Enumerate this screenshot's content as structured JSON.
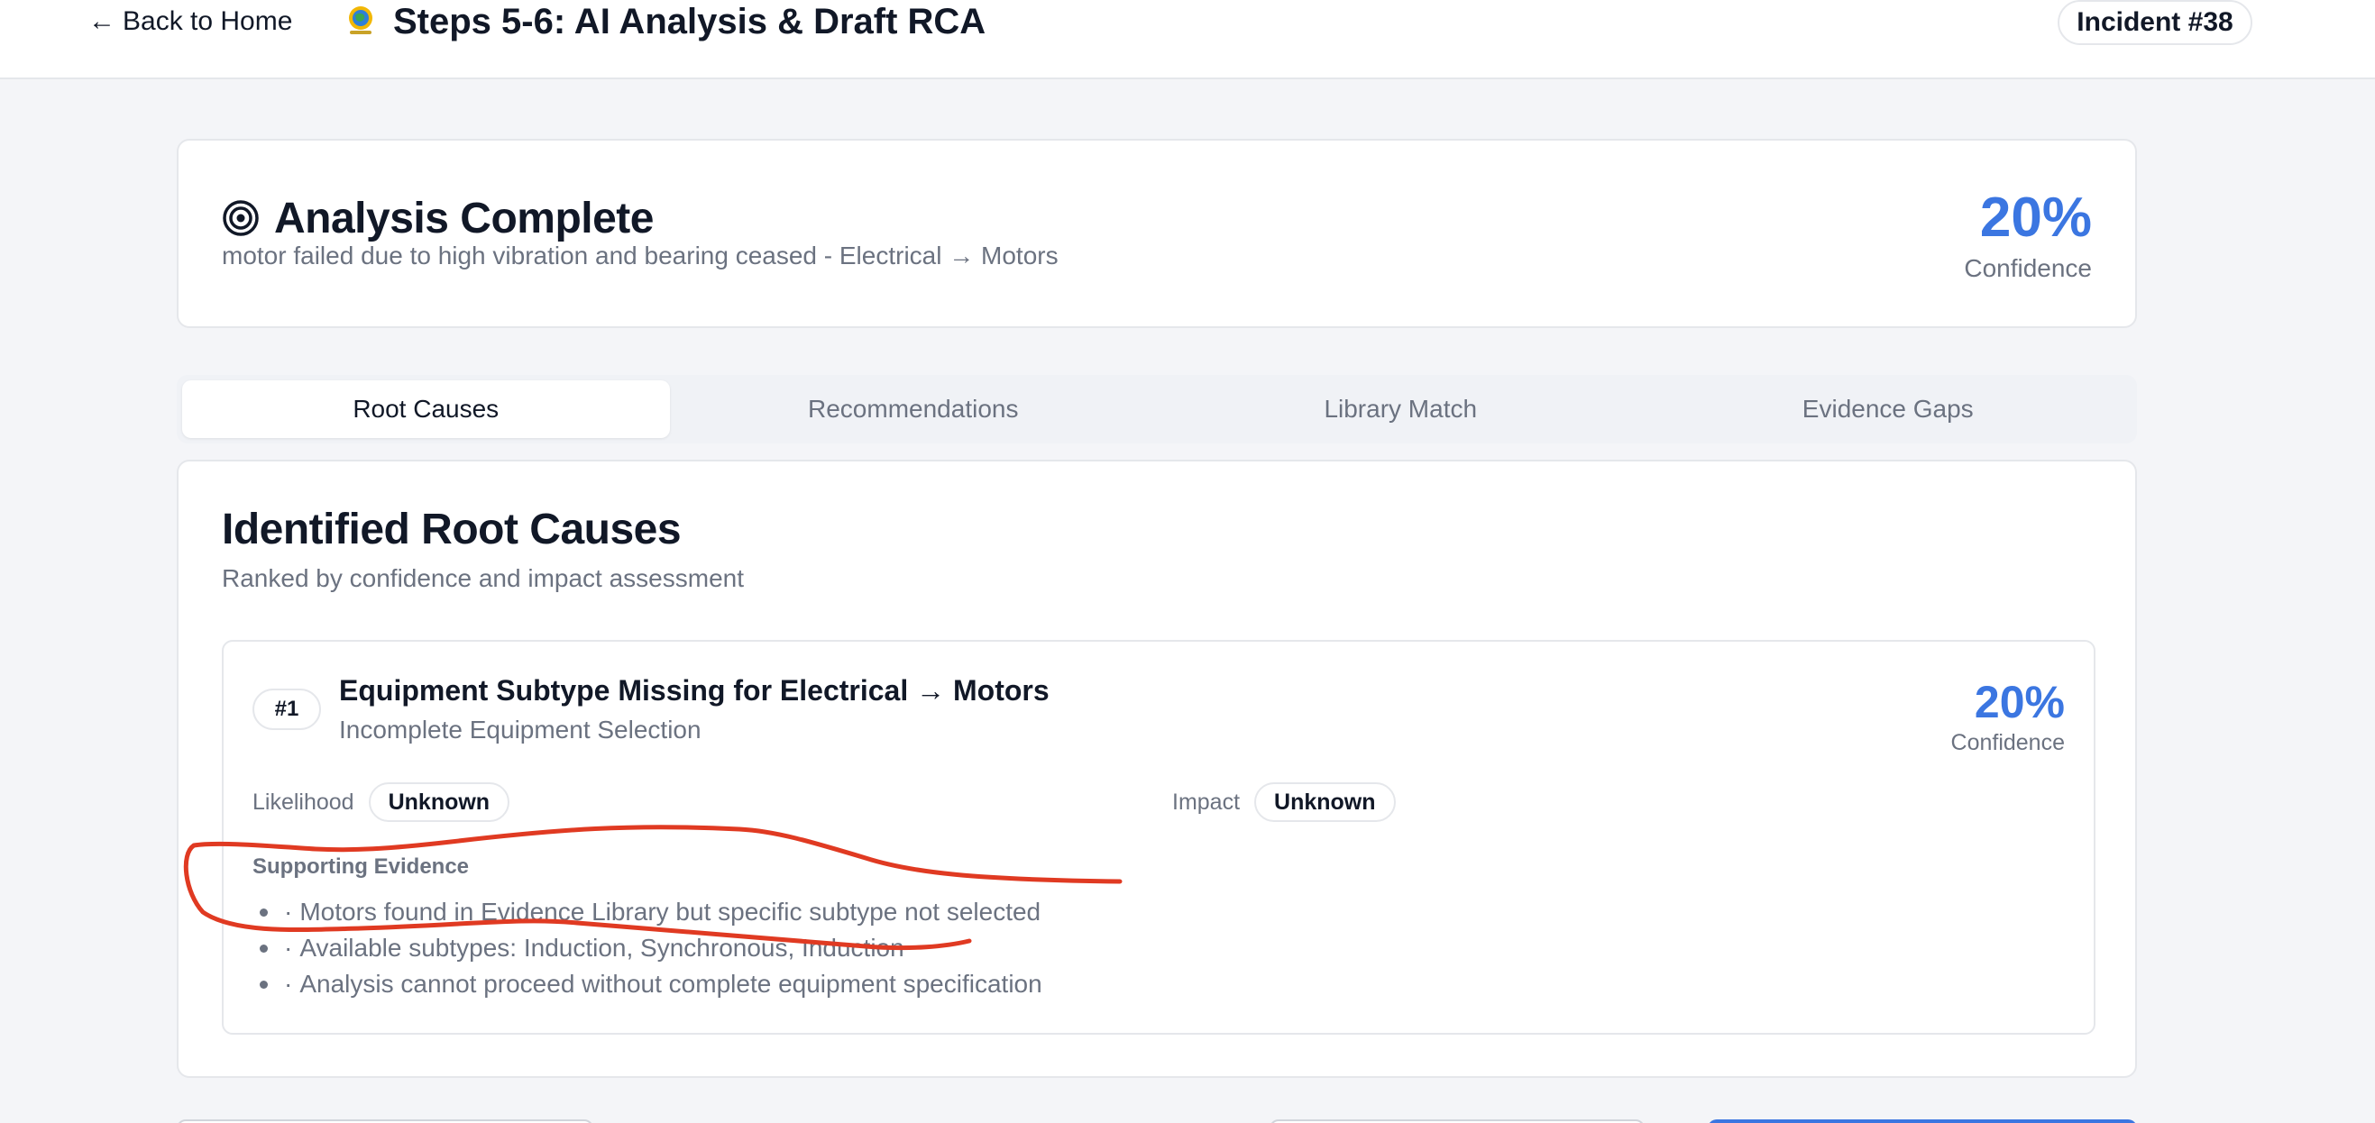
{
  "header": {
    "back_label": "Back to Home",
    "title": "Steps 5-6: AI Analysis & Draft RCA",
    "incident_badge": "Incident #38"
  },
  "analysis": {
    "title": "Analysis Complete",
    "subtitle": "motor failed due to high vibration and bearing ceased - Electrical → Motors",
    "confidence_value": "20%",
    "confidence_label": "Confidence"
  },
  "tabs": [
    {
      "label": "Root Causes",
      "active": true
    },
    {
      "label": "Recommendations",
      "active": false
    },
    {
      "label": "Library Match",
      "active": false
    },
    {
      "label": "Evidence Gaps",
      "active": false
    }
  ],
  "root_causes": {
    "title": "Identified Root Causes",
    "subtitle": "Ranked by confidence and impact assessment",
    "items": [
      {
        "rank": "#1",
        "title": "Equipment Subtype Missing for Electrical → Motors",
        "category": "Incomplete Equipment Selection",
        "confidence_value": "20%",
        "confidence_label": "Confidence",
        "likelihood_label": "Likelihood",
        "likelihood_value": "Unknown",
        "impact_label": "Impact",
        "impact_value": "Unknown",
        "evidence_label": "Supporting Evidence",
        "evidence": [
          "Motors found in Evidence Library but specific subtype not selected",
          "Available subtypes: Induction, Synchronous, Induction",
          "Analysis cannot proceed without complete equipment specification"
        ]
      }
    ]
  },
  "icons": {
    "back": "arrow-left-icon",
    "logo": "globe-logo-icon",
    "analysis": "target-icon"
  },
  "colors": {
    "accent": "#3b76e1",
    "annotation": "#e03a22",
    "muted_text": "#6b7280"
  }
}
